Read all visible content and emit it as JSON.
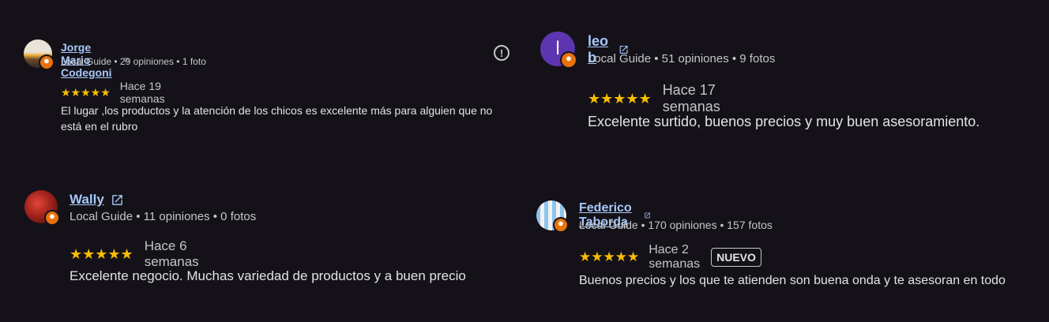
{
  "colors": {
    "background": "#141218",
    "name_link": "#a8c7fa",
    "star": "#fbbc04",
    "guide_badge": "#e8710a",
    "leo_avatar": "#5e35b1"
  },
  "reviews": [
    {
      "name": "Jorge Mario Codegoni",
      "meta": "Local Guide • 29 opiniones • 1 foto",
      "rating": 5,
      "when": "Hace 19 semanas",
      "text": "El lugar ,los productos y la atención de los chicos es excelente más para alguien que no está en el rubro",
      "icons": [
        "open-in-new-icon",
        "report-icon"
      ]
    },
    {
      "name": "leo b",
      "avatar_letter": "l",
      "meta": "Local Guide • 51 opiniones • 9 fotos",
      "rating": 5,
      "when": "Hace 17 semanas",
      "text": "Excelente surtido, buenos precios y muy buen asesoramiento."
    },
    {
      "name": "Wally",
      "meta": "Local Guide • 11 opiniones • 0 fotos",
      "rating": 5,
      "when": "Hace 6 semanas",
      "text": "Excelente negocio. Muchas variedad de productos y a buen precio"
    },
    {
      "name": "Federico Taborda",
      "meta": "Local Guide • 170 opiniones • 157 fotos",
      "rating": 5,
      "when": "Hace 2 semanas",
      "badge": "NUEVO",
      "text": "Buenos precios y los que te atienden son buena onda y te asesoran en todo"
    }
  ]
}
